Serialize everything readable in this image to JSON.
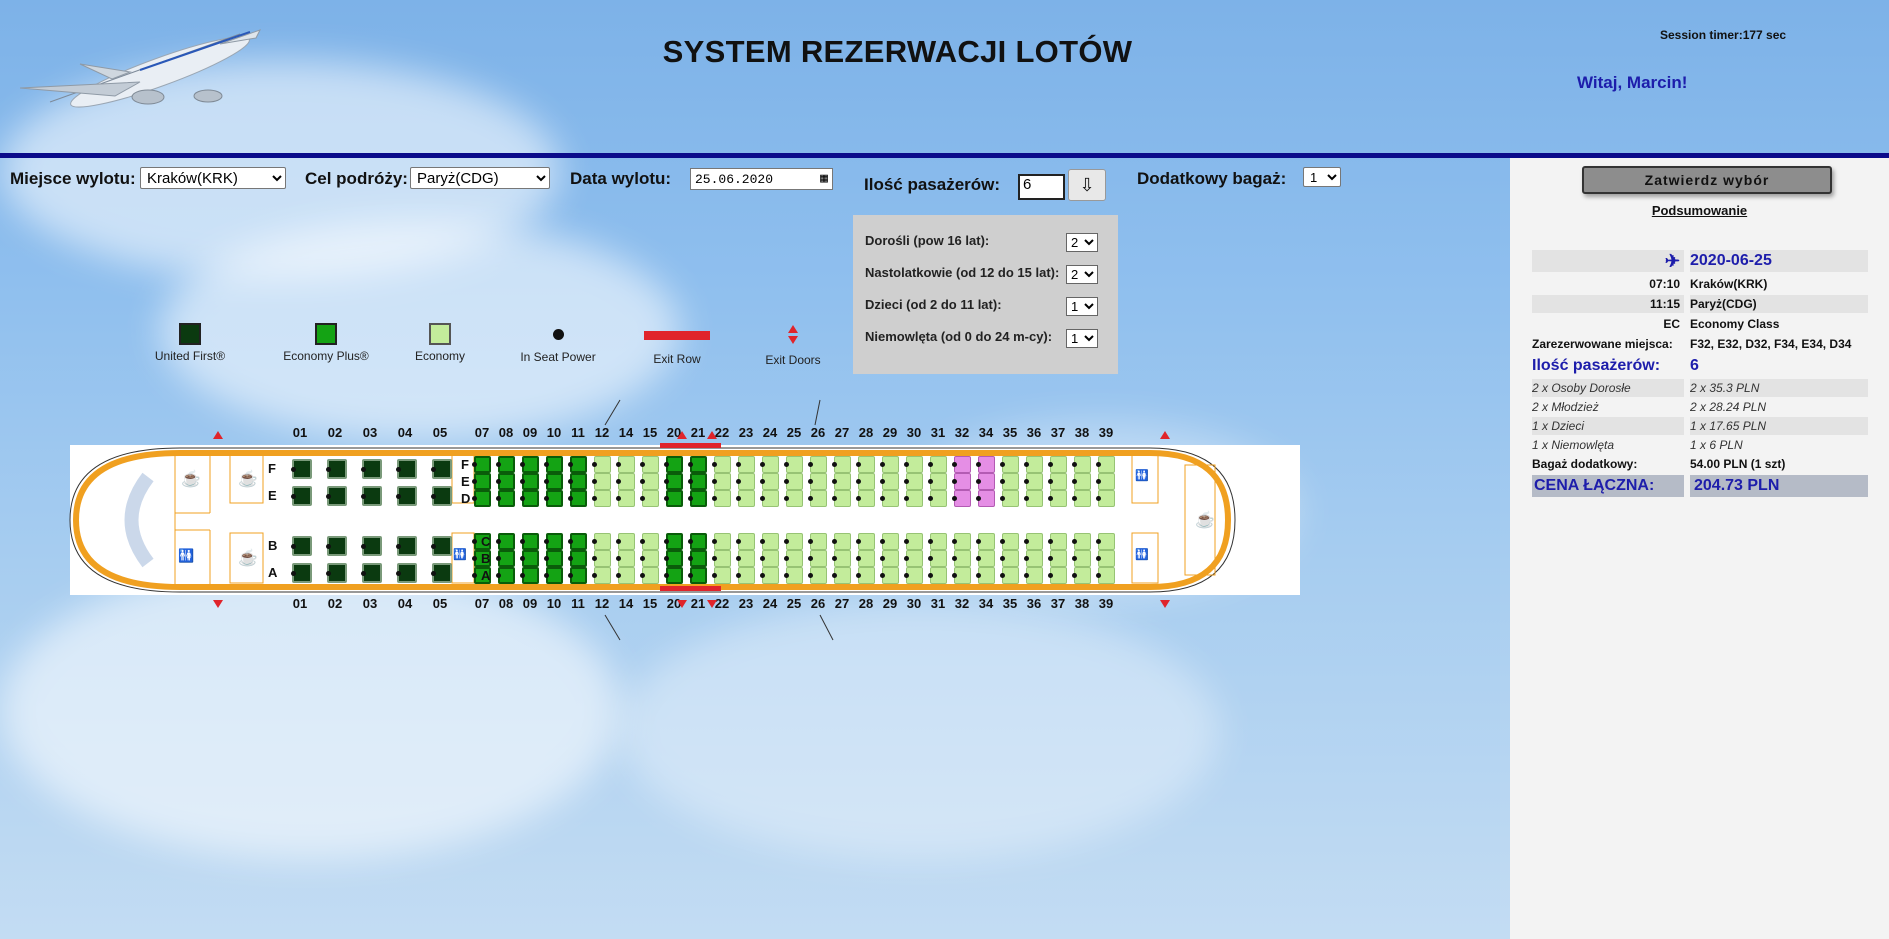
{
  "header": {
    "title": "SYSTEM REZERWACJI LOTÓW",
    "session_timer": "Session timer:177 sec",
    "greeting": "Witaj, Marcin!"
  },
  "controls": {
    "origin_label": "Miejsce wylotu:",
    "origin_value": "Kraków(KRK)",
    "destination_label": "Cel podróży:",
    "destination_value": "Paryż(CDG)",
    "date_label": "Data wylotu:",
    "date_value": "25.06.2020",
    "passengers_label": "Ilość pasażerów:",
    "passengers_value": "6",
    "baggage_label": "Dodatkowy bagaż:",
    "baggage_value": "1"
  },
  "passenger_panel": {
    "adults_label": "Dorośli (pow 16 lat):",
    "adults_value": "2",
    "teens_label": "Nastolatkowie (od 12 do 15 lat):",
    "teens_value": "2",
    "children_label": "Dzieci (od 2 do 11 lat):",
    "children_value": "1",
    "infants_label": "Niemowlęta (od 0 do 24 m-cy):",
    "infants_value": "1"
  },
  "legend": [
    {
      "label": "United First®",
      "type": "first"
    },
    {
      "label": "Economy Plus®",
      "type": "plus"
    },
    {
      "label": "Economy",
      "type": "eco"
    },
    {
      "label": "In Seat Power",
      "type": "power"
    },
    {
      "label": "Exit Row",
      "type": "exitrow"
    },
    {
      "label": "Exit Doors",
      "type": "exitdoors"
    }
  ],
  "seatmap": {
    "first_rows": [
      "01",
      "02",
      "03",
      "04",
      "05"
    ],
    "rows": [
      "07",
      "08",
      "09",
      "10",
      "11",
      "12",
      "14",
      "15",
      "20",
      "21",
      "22",
      "23",
      "24",
      "25",
      "26",
      "27",
      "28",
      "29",
      "30",
      "31",
      "32",
      "34",
      "35",
      "36",
      "37",
      "38",
      "39"
    ],
    "first_letters_top": [
      "F",
      "E"
    ],
    "first_letters_bottom": [
      "B",
      "A"
    ],
    "letters_top": [
      "F",
      "E",
      "D"
    ],
    "letters_bottom": [
      "C",
      "B",
      "A"
    ],
    "plus_rows": [
      "07",
      "08",
      "09",
      "10",
      "11",
      "20",
      "21"
    ],
    "taken_seats": [
      "F32",
      "E32",
      "D32",
      "F34",
      "E34",
      "D34"
    ]
  },
  "summary": {
    "confirm_button": "Zatwierdz wybór",
    "summary_link": "Podsumowanie",
    "date": "2020-06-25",
    "dep_time": "07:10",
    "dep_place": "Kraków(KRK)",
    "arr_time": "11:15",
    "arr_place": "Paryż(CDG)",
    "class_code": "EC",
    "class_name": "Economy Class",
    "reserved_label": "Zarezerwowane miejsca:",
    "reserved_value": "F32, E32, D32, F34, E34, D34",
    "pax_label": "Ilość pasażerów:",
    "pax_value": "6",
    "lines": [
      {
        "k": "2 x Osoby Dorosłe",
        "v": "2 x 35.3 PLN"
      },
      {
        "k": "2 x Młodzież",
        "v": "2 x 28.24 PLN"
      },
      {
        "k": "1 x Dzieci",
        "v": "1 x 17.65 PLN"
      },
      {
        "k": "1 x Niemowlęta",
        "v": "1 x 6 PLN"
      }
    ],
    "baggage_label": "Bagaż dodatkowy:",
    "baggage_value": "54.00 PLN (1 szt)",
    "total_label": "CENA ŁĄCZNA:",
    "total_value": "204.73 PLN"
  },
  "colors": {
    "accent": "#0b0b8a",
    "greeting": "#1d1dab",
    "first": "#0b3a10",
    "plus": "#14a314",
    "economy": "#c3ec9b",
    "taken": "#e58ee5",
    "exit": "#e0242b",
    "fuselage": "#f0a020"
  }
}
